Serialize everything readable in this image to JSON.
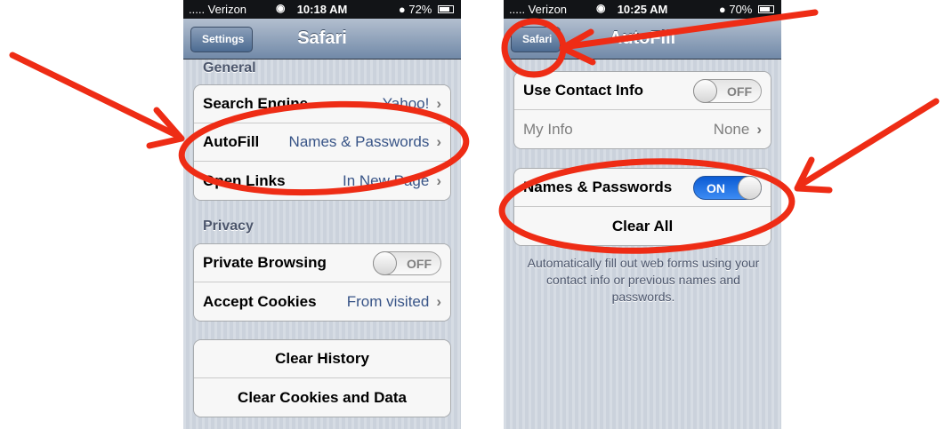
{
  "left_screen": {
    "status": {
      "carrier": "..... Verizon",
      "time": "10:18 AM",
      "battery": "72%"
    },
    "nav": {
      "title": "Safari",
      "back_label": "Settings"
    },
    "general_header": "General",
    "general_rows": [
      {
        "label": "Search Engine",
        "value": "Yahoo!"
      },
      {
        "label": "AutoFill",
        "value": "Names & Passwords"
      },
      {
        "label": "Open Links",
        "value": "In New Page"
      }
    ],
    "privacy_header": "Privacy",
    "private_browsing": {
      "label": "Private Browsing",
      "state": "OFF"
    },
    "accept_cookies": {
      "label": "Accept Cookies",
      "value": "From visited"
    },
    "clear_history": "Clear History",
    "clear_cookies": "Clear Cookies and Data"
  },
  "right_screen": {
    "status": {
      "carrier": "..... Verizon",
      "time": "10:25 AM",
      "battery": "70%"
    },
    "nav": {
      "title": "AutoFill",
      "back_label": "Safari"
    },
    "use_contact_info": {
      "label": "Use Contact Info",
      "state": "OFF"
    },
    "my_info": {
      "label": "My Info",
      "value": "None"
    },
    "names_passwords": {
      "label": "Names & Passwords",
      "state": "ON"
    },
    "clear_all": "Clear All",
    "footer": "Automatically fill out web forms using your contact info or previous names and passwords."
  },
  "annotation_color": "#ee2c15"
}
